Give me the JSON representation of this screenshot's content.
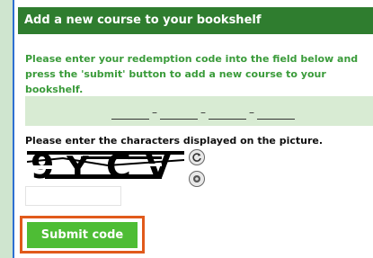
{
  "dialog": {
    "title": "Add a new course to your bookshelf",
    "instructions": "Please enter your redemption code into the field below and press the 'submit' button to add a new course to your bookshelf."
  },
  "redemption_code": {
    "separator": "–",
    "segments": [
      "",
      "",
      "",
      ""
    ]
  },
  "captcha": {
    "label": "Please enter the characters displayed on the picture.",
    "image_text": "9YCV",
    "input_value": "",
    "refresh_icon": "refresh-icon",
    "audio_icon": "audio-icon"
  },
  "submit": {
    "label": "Submit code"
  },
  "colors": {
    "header_bg": "#2f7d2f",
    "instruction_text": "#3a9b3a",
    "code_band": "#d8ebd3",
    "submit_bg": "#4ebd35",
    "highlight": "#e15a1b"
  }
}
